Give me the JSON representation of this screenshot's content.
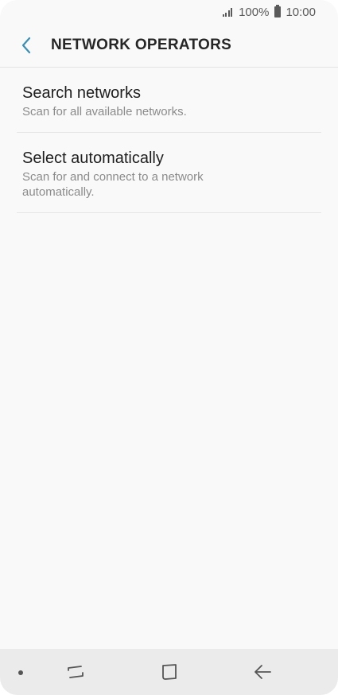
{
  "status_bar": {
    "battery": "100%",
    "time": "10:00",
    "icons": [
      "signal-icon",
      "battery-icon"
    ]
  },
  "header": {
    "title": "NETWORK OPERATORS",
    "back_icon": "chevron-left-icon",
    "accent_color": "#3a8fb7"
  },
  "items": [
    {
      "title": "Search networks",
      "description": "Scan for all available networks."
    },
    {
      "title": "Select automatically",
      "description": "Scan for and connect to a network automatically."
    }
  ],
  "nav_bar": {
    "icons": [
      "recent-apps-icon",
      "home-icon",
      "back-arrow-icon"
    ]
  }
}
